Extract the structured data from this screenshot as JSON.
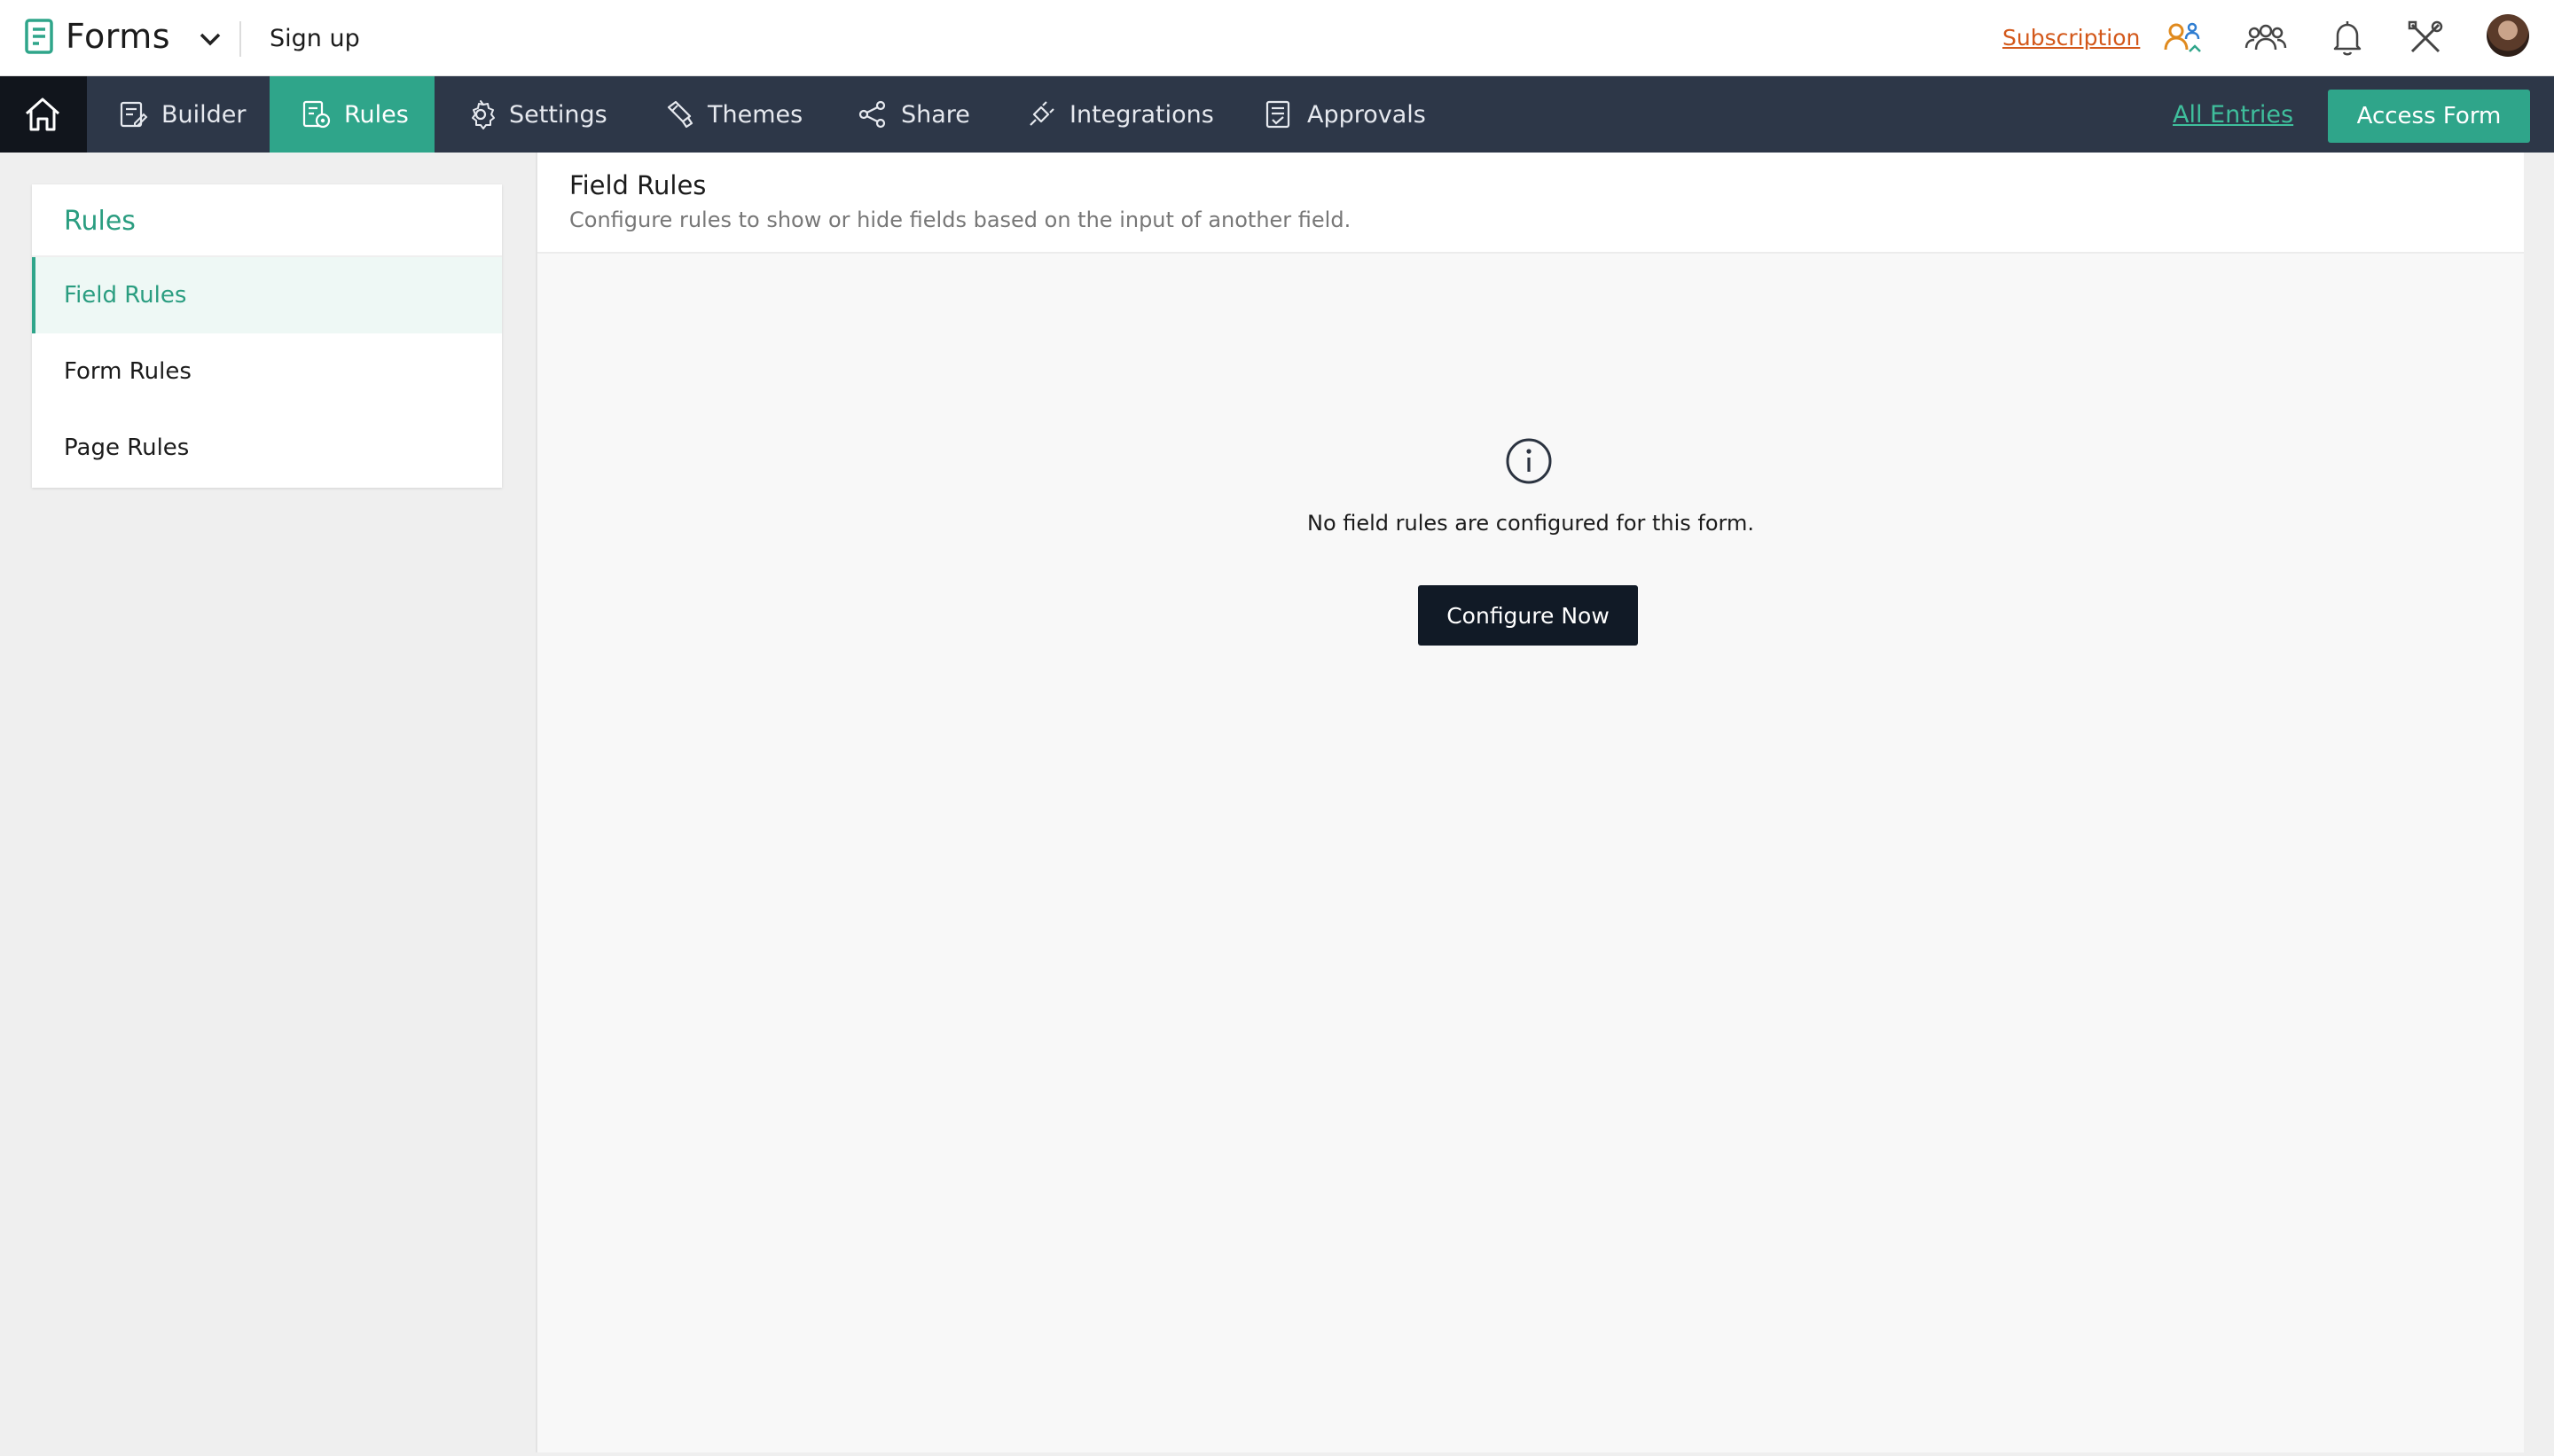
{
  "app": {
    "brand": "Forms",
    "form_name": "Sign up"
  },
  "topbar": {
    "subscription_label": "Subscription",
    "icons": [
      "user-switch-icon",
      "team-icon",
      "bell-icon",
      "tools-icon",
      "avatar"
    ]
  },
  "nav": {
    "items": [
      {
        "label": "Builder",
        "icon": "builder-icon"
      },
      {
        "label": "Rules",
        "icon": "rules-icon",
        "active": true
      },
      {
        "label": "Settings",
        "icon": "gear-icon"
      },
      {
        "label": "Themes",
        "icon": "brush-icon"
      },
      {
        "label": "Share",
        "icon": "share-icon"
      },
      {
        "label": "Integrations",
        "icon": "plug-icon"
      },
      {
        "label": "Approvals",
        "icon": "approvals-icon"
      }
    ],
    "all_entries_label": "All Entries",
    "access_form_label": "Access Form"
  },
  "sidebar": {
    "title": "Rules",
    "items": [
      {
        "label": "Field Rules",
        "active": true
      },
      {
        "label": "Form Rules"
      },
      {
        "label": "Page Rules"
      }
    ]
  },
  "main": {
    "title": "Field Rules",
    "description": "Configure rules to show or hide fields based on the input of another field.",
    "empty_message": "No field rules are configured for this form.",
    "configure_label": "Configure Now"
  },
  "colors": {
    "accent": "#2fa58a",
    "nav_bg": "#2d3748",
    "home_bg": "#11151c",
    "subscription": "#d3581a",
    "primary_dark": "#111a26"
  }
}
